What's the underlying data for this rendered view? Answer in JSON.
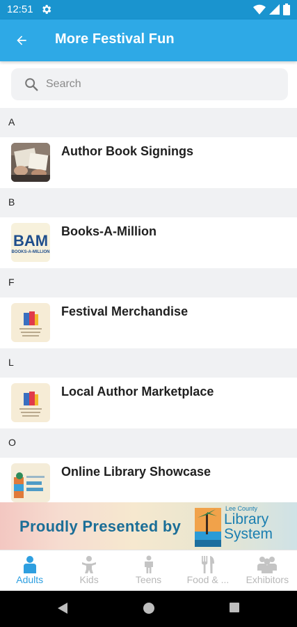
{
  "status_bar": {
    "time": "12:51",
    "icons": [
      "settings-gear-icon",
      "wifi-icon",
      "signal-icon",
      "battery-icon"
    ]
  },
  "app_bar": {
    "back_icon": "arrow-back-icon",
    "title": "More Festival Fun"
  },
  "search": {
    "placeholder": "Search",
    "value": "",
    "icon": "search-icon"
  },
  "sections": [
    {
      "letter": "A",
      "items": [
        {
          "label": "Author Book Signings",
          "thumb": "book-signing-photo"
        }
      ]
    },
    {
      "letter": "B",
      "items": [
        {
          "label": "Books-A-Million",
          "thumb": "bam-logo"
        }
      ]
    },
    {
      "letter": "F",
      "items": [
        {
          "label": "Festival Merchandise",
          "thumb": "reading-festival-logo"
        }
      ]
    },
    {
      "letter": "L",
      "items": [
        {
          "label": "Local Author Marketplace",
          "thumb": "reading-festival-logo"
        }
      ]
    },
    {
      "letter": "O",
      "items": [
        {
          "label": "Online Library Showcase",
          "thumb": "library-system-logo"
        }
      ]
    }
  ],
  "thumb_text": {
    "bam": "BAM",
    "bam_sub": "BOOKS-A-MILLION"
  },
  "banner": {
    "text": "Proudly Presented by",
    "org_small": "Lee County",
    "org_line1": "Library",
    "org_line2": "System"
  },
  "bottom_nav": {
    "active_color": "#2e9fe0",
    "inactive_color": "#b8b8b8",
    "items": [
      {
        "label": "Adults",
        "icon": "adult-person-icon",
        "active": true
      },
      {
        "label": "Kids",
        "icon": "kid-icon",
        "active": false
      },
      {
        "label": "Teens",
        "icon": "teen-person-icon",
        "active": false
      },
      {
        "label": "Food & ...",
        "icon": "fork-knife-icon",
        "active": false
      },
      {
        "label": "Exhibitors",
        "icon": "group-people-icon",
        "active": false
      }
    ]
  },
  "colors": {
    "app_bar": "#2ea9e6",
    "status_bar": "#1a94cf",
    "section_header_bg": "#f0f1f3"
  }
}
